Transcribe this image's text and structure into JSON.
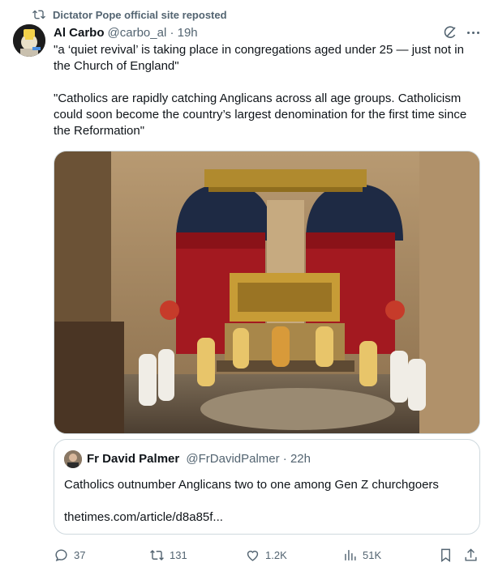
{
  "repost": {
    "text": "Dictator Pope official site reposted",
    "icon": "repost-icon"
  },
  "tweet": {
    "author_name": "Al Carbo",
    "meta": "@carbo_al · 19h",
    "paragraphs": [
      "\"a ‘quiet revival’ is taking place in congregations aged under 25 — just not in the Church of England\"",
      "\"Catholics are rapidly catching Anglicans across all age groups. Catholicism could soon become the country’s largest denomination for the first time since the Reformation\""
    ],
    "media_icon": "church-interior-photo"
  },
  "quote": {
    "author_name": "Fr David Palmer",
    "meta": "@FrDavidPalmer · 22h",
    "text": "Catholics outnumber Anglicans two to one among Gen Z churchgoers",
    "link": "thetimes.com/article/d8a85f..."
  },
  "actions": {
    "replies": "37",
    "reposts": "131",
    "likes": "1.2K",
    "views": "51K"
  },
  "colors": {
    "text": "#0f1419",
    "muted": "#536471",
    "border": "#cfd9de"
  }
}
